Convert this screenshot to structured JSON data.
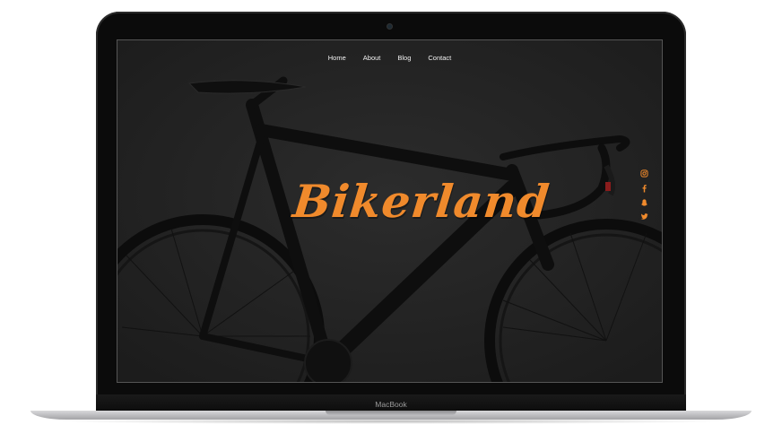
{
  "device": {
    "brand_label": "MacBook"
  },
  "site": {
    "nav": [
      "Home",
      "About",
      "Blog",
      "Contact"
    ],
    "logo_text": "Bikerland",
    "accent_color": "#f08a2c",
    "social_icons": [
      "instagram-icon",
      "facebook-icon",
      "snapchat-icon",
      "twitter-icon"
    ]
  }
}
